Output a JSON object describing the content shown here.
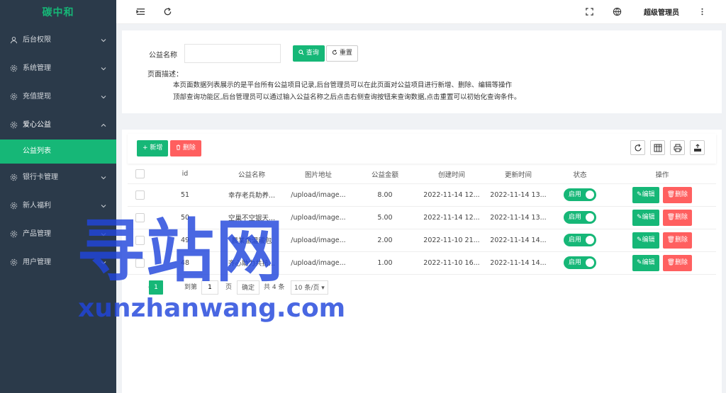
{
  "brand": "碳中和",
  "sidebar": {
    "items": [
      {
        "label": "后台权限",
        "icon": "user-icon"
      },
      {
        "label": "系统管理",
        "icon": "gear-icon"
      },
      {
        "label": "充值提现",
        "icon": "gear-icon"
      },
      {
        "label": "爱心公益",
        "icon": "gear-icon",
        "open": true
      },
      {
        "label": "银行卡管理",
        "icon": "gear-icon"
      },
      {
        "label": "新人福利",
        "icon": "gear-icon"
      },
      {
        "label": "产品管理",
        "icon": "gear-icon"
      },
      {
        "label": "用户管理",
        "icon": "gear-icon"
      }
    ],
    "sub_item": "公益列表"
  },
  "header": {
    "user": "超级管理员"
  },
  "search": {
    "label": "公益名称",
    "value": "",
    "query_button": "查询",
    "reset_button": "重置",
    "desc_title": "页面描述：",
    "desc_line1": "本页面数据列表展示的是平台所有公益项目记录,后台管理员可以在此页面对公益项目进行新增、删除、编辑等操作",
    "desc_line2": "顶部查询功能区,后台管理员可以通过输入公益名称之后点击右侧查询按钮来查询数据,点击重置可以初始化查询条件。"
  },
  "toolbar": {
    "add_button": "+ 新增",
    "delete_button": "删除"
  },
  "table": {
    "headers": [
      "id",
      "公益名称",
      "图片地址",
      "公益金额",
      "创建时间",
      "更新时间",
      "状态",
      "操作"
    ],
    "rows": [
      {
        "id": "51",
        "name": "幸存老兵助养...",
        "img": "/upload/image...",
        "amount": "8.00",
        "created": "2022-11-14 12...",
        "updated": "2022-11-14 13...",
        "status": "启用"
      },
      {
        "id": "50",
        "name": "空巢不空银天...",
        "img": "/upload/image...",
        "amount": "5.00",
        "created": "2022-11-14 12...",
        "updated": "2022-11-14 13...",
        "status": "启用"
      },
      {
        "id": "49",
        "name": "晨某金温暖包",
        "img": "/upload/image...",
        "amount": "2.00",
        "created": "2022-11-10 21...",
        "updated": "2022-11-14 14...",
        "status": "启用"
      },
      {
        "id": "48",
        "name": "齐心助力共抗...",
        "img": "/upload/image...",
        "amount": "1.00",
        "created": "2022-11-10 16...",
        "updated": "2022-11-14 14...",
        "status": "启用"
      }
    ],
    "edit_label": "编辑",
    "delete_label": "删除"
  },
  "pager": {
    "current": "1",
    "goto_label": "到第",
    "goto_value": "1",
    "page_suffix": "页",
    "confirm": "确定",
    "total": "共 4 条",
    "size": "10 条/页"
  },
  "watermark": {
    "cn": "寻站网",
    "en": "xunzhanwang.com"
  },
  "colors": {
    "accent": "#16b777",
    "danger": "#ff5f5f",
    "sidebar_bg": "#2b3a4a",
    "watermark": "#2146dc"
  }
}
